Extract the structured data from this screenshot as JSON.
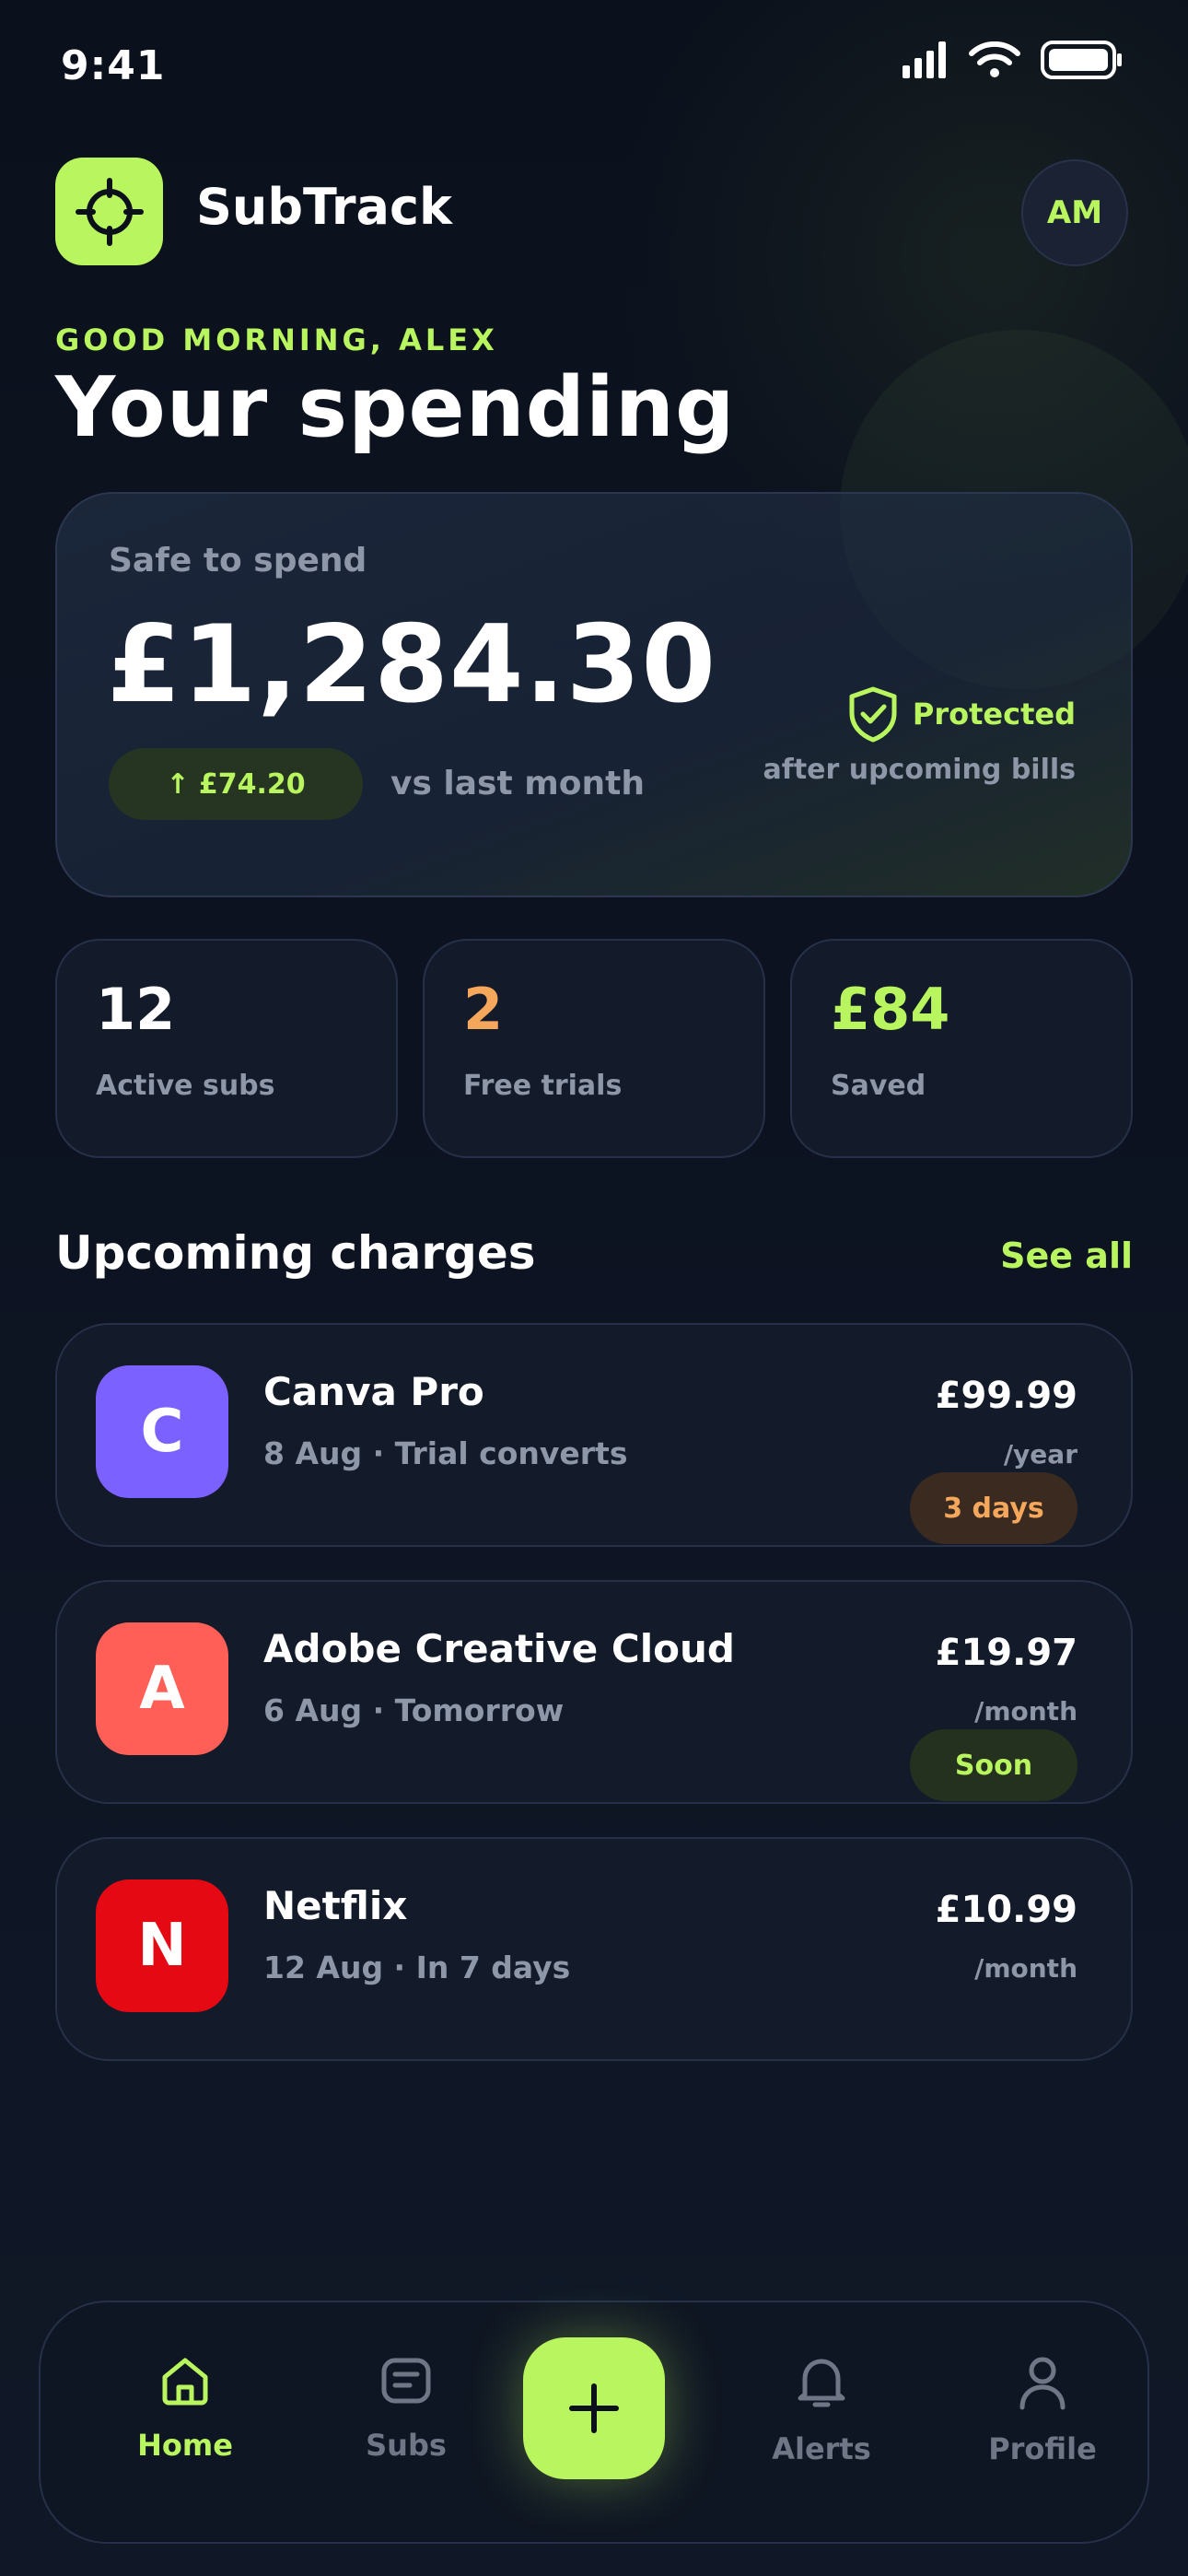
{
  "status_bar": {
    "time": "9:41"
  },
  "header": {
    "app_name": "SubTrack",
    "avatar_initials": "AM"
  },
  "greeting": "GOOD MORNING, ALEX",
  "page_title": "Your spending",
  "hero": {
    "label": "Safe to spend",
    "amount": "£1,284.30",
    "delta": "↑ £74.20",
    "delta_caption": "vs last month",
    "protected_label": "Protected",
    "protected_sub": "after upcoming bills"
  },
  "stats": [
    {
      "value": "12",
      "label": "Active subs",
      "color": "#ffffff"
    },
    {
      "value": "2",
      "label": "Free trials",
      "color": "#f5a75b"
    },
    {
      "value": "£84",
      "label": "Saved",
      "color": "#b9f55e"
    }
  ],
  "upcoming": {
    "title": "Upcoming charges",
    "see_all": "See all",
    "items": [
      {
        "initial": "C",
        "name": "Canva Pro",
        "meta": "8 Aug · Trial converts",
        "price": "£99.99",
        "period": "/year",
        "badge": "3 days",
        "icon_color": "#7b61ff",
        "badge_bg": "#3a2a1f",
        "badge_color": "#f5a75b"
      },
      {
        "initial": "A",
        "name": "Adobe Creative Cloud",
        "meta": "6 Aug · Tomorrow",
        "price": "£19.97",
        "period": "/month",
        "badge": "Soon",
        "icon_color": "#ff5f57",
        "badge_bg": "#24311f",
        "badge_color": "#b9f55e"
      },
      {
        "initial": "N",
        "name": "Netflix",
        "meta": "12 Aug · In 7 days",
        "price": "£10.99",
        "period": "/month",
        "badge": "",
        "icon_color": "#e50914"
      }
    ]
  },
  "nav": {
    "items": [
      {
        "label": "Home",
        "icon": "home-icon",
        "active": true
      },
      {
        "label": "Subs",
        "icon": "list-icon"
      },
      {
        "label": "Alerts",
        "icon": "bell-icon"
      },
      {
        "label": "Profile",
        "icon": "profile-icon"
      }
    ],
    "fab_icon": "plus-icon"
  },
  "colors": {
    "accent": "#b9f55e",
    "background": "#0b101b",
    "card": "#131b2a",
    "muted": "#8e97a8"
  }
}
